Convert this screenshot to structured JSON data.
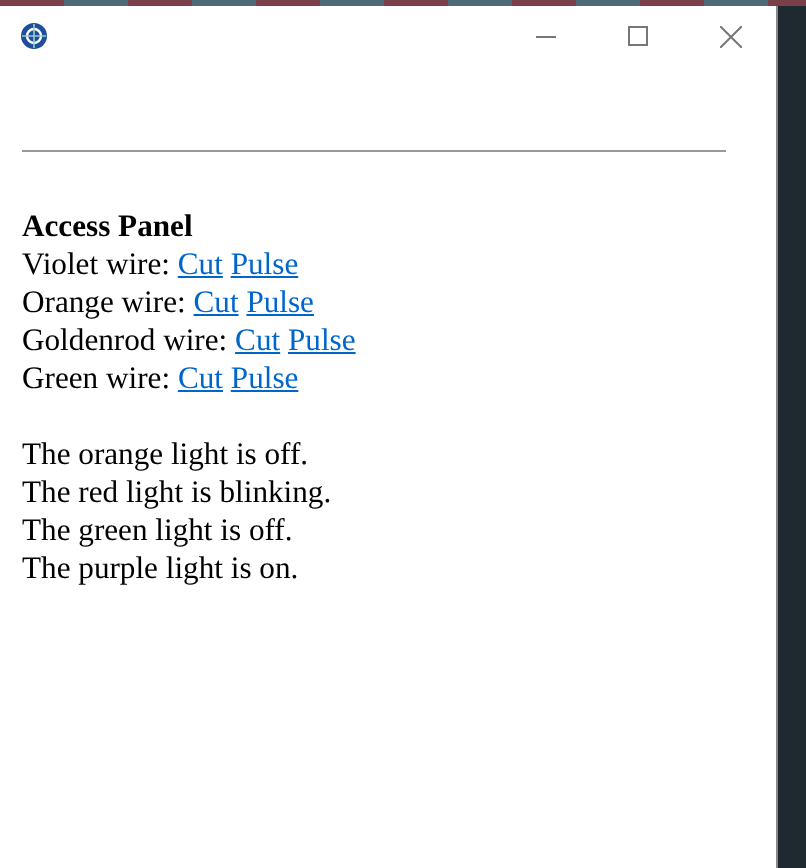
{
  "panel": {
    "title": "Access Panel",
    "wires": [
      {
        "label": "Violet wire:",
        "actions": [
          "Cut",
          "Pulse"
        ]
      },
      {
        "label": "Orange wire:",
        "actions": [
          "Cut",
          "Pulse"
        ]
      },
      {
        "label": "Goldenrod wire:",
        "actions": [
          "Cut",
          "Pulse"
        ]
      },
      {
        "label": "Green wire:",
        "actions": [
          "Cut",
          "Pulse"
        ]
      }
    ],
    "lights": [
      "The orange light is off.",
      "The red light is blinking.",
      "The green light is off.",
      "The purple light is on."
    ]
  }
}
